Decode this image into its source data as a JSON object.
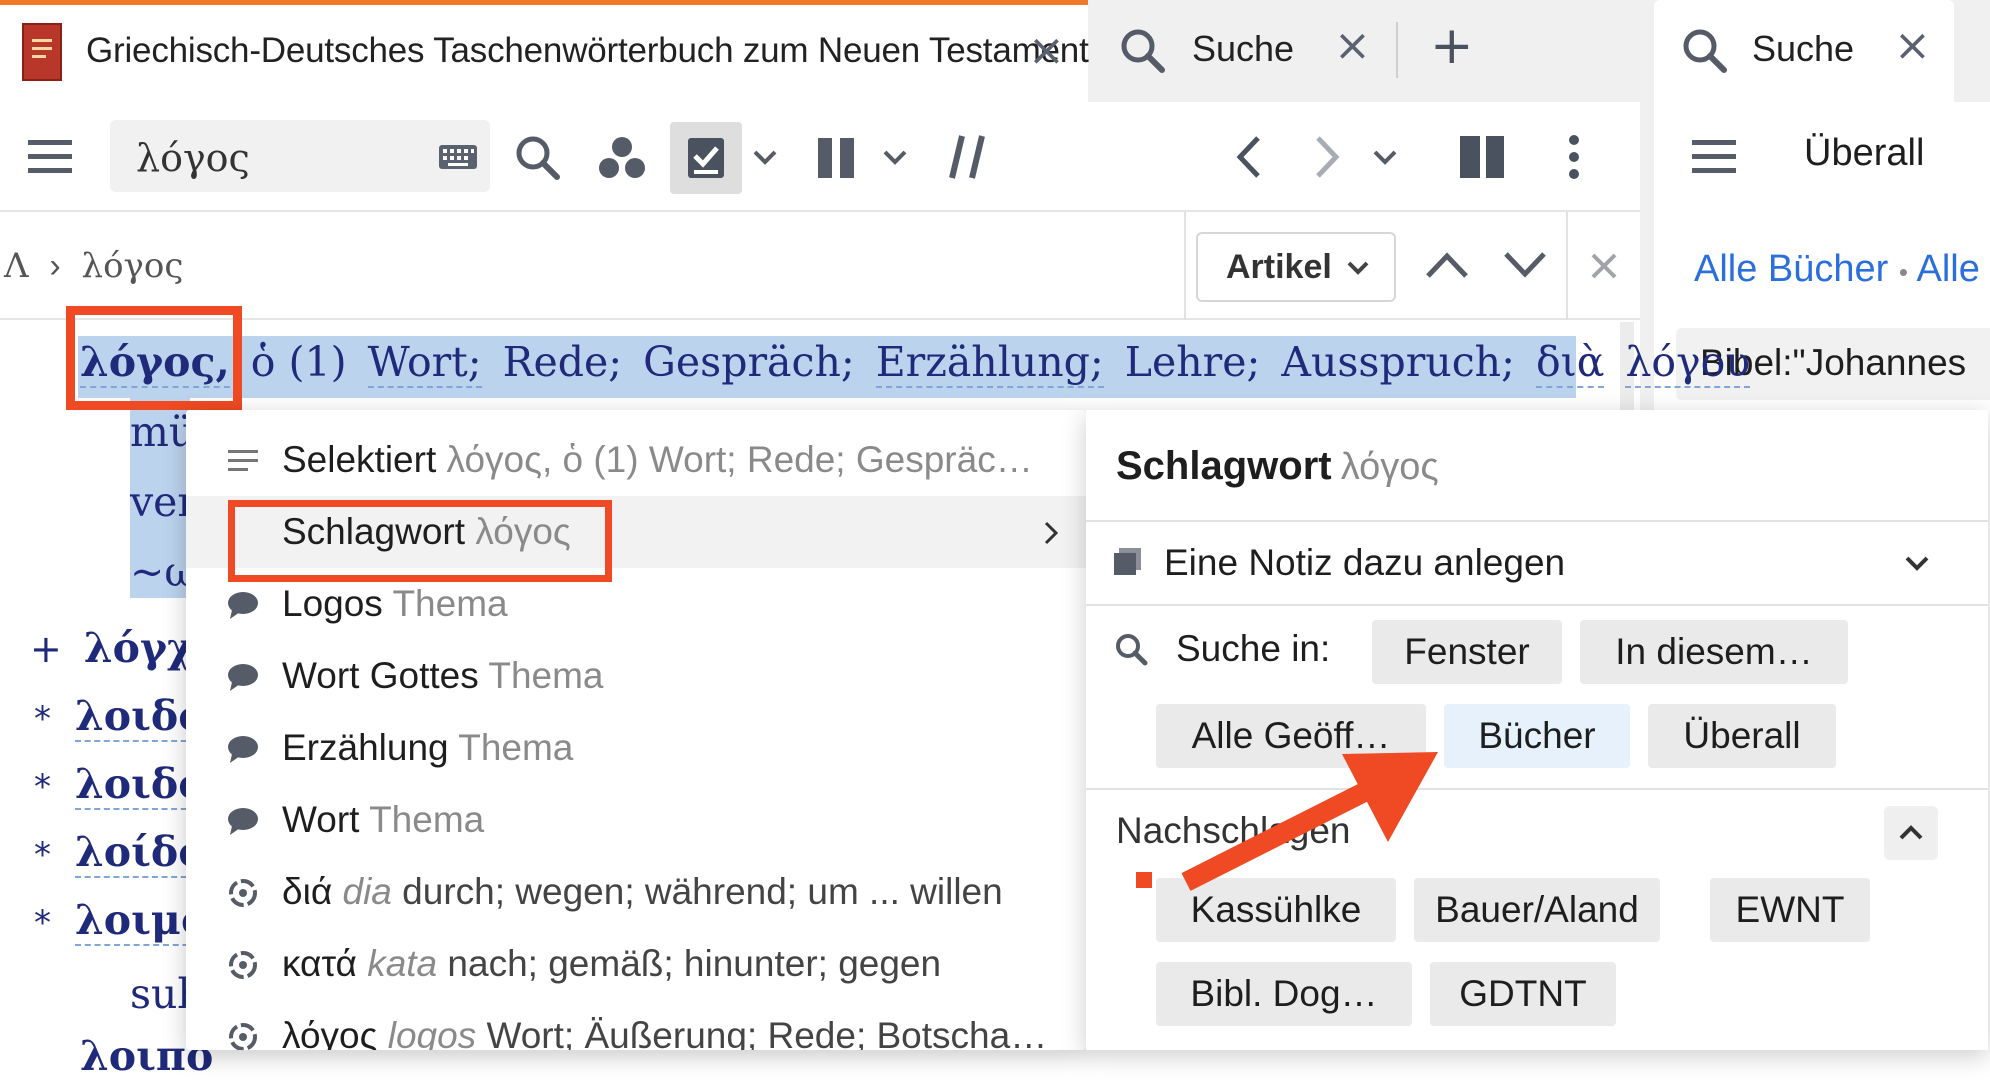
{
  "tabs": {
    "book_title": "Griechisch-Deutsches Taschenwörterbuch zum Neuen Testament",
    "search_tab": "Suche",
    "right_search_tab": "Suche"
  },
  "toolbar": {
    "search_value": "λόγος"
  },
  "right_toolbar": {
    "scope": "Überall"
  },
  "right_panel": {
    "books_link": "Alle Bücher",
    "bullet": "•",
    "alle_partial": "Alle",
    "query": "Bibel:\"Johannes"
  },
  "breadcrumb": {
    "root": "Λ",
    "sep": "›",
    "current": "λόγος"
  },
  "nav": {
    "artikel": "Artikel"
  },
  "article": {
    "headword": "λόγος,",
    "line1_rest": "ὁ (1)",
    "line1_words": [
      "Wort;",
      "Rede;",
      "Gespräch;",
      "Erzählung;",
      "Lehre;",
      "Ausspruch;",
      "διὰ",
      "λόγου"
    ],
    "line2_fragment": "mü",
    "line3_fragment": "ver",
    "line4_fragment": "~ω",
    "entries": [
      {
        "marker": "+",
        "word": "λόγχι"
      },
      {
        "marker": "*",
        "word": "λοιδο"
      },
      {
        "marker": "*",
        "word": "λοιδο"
      },
      {
        "marker": "*",
        "word": "λοίδο"
      },
      {
        "marker": "*",
        "word": "λοιμό"
      }
    ],
    "sub_fragment": "sub",
    "last_fragment": "λοιπό"
  },
  "context_menu": [
    {
      "label": "Selektiert",
      "detail": "λόγος, ὁ (1) Wort; Rede; Gespräc…",
      "icon": "lines-icon"
    },
    {
      "label": "Schlagwort",
      "detail": "λόγος",
      "icon": "none"
    },
    {
      "label": "Logos",
      "detail": "Thema",
      "icon": "speech-bubble-icon"
    },
    {
      "label": "Wort Gottes",
      "detail": "Thema",
      "icon": "speech-bubble-icon"
    },
    {
      "label": "Erzählung",
      "detail": "Thema",
      "icon": "speech-bubble-icon"
    },
    {
      "label": "Wort",
      "detail": "Thema",
      "icon": "speech-bubble-icon"
    },
    {
      "label": "διά",
      "detail_italic": "dia",
      "detail": "durch; wegen; während; um ... willen",
      "icon": "lemma-icon"
    },
    {
      "label": "κατά",
      "detail_italic": "kata",
      "detail": "nach; gemäß; hinunter; gegen",
      "icon": "lemma-icon"
    },
    {
      "label": "λόγος",
      "detail_italic": "logos",
      "detail": "Wort; Äußerung; Rede; Botscha…",
      "icon": "lemma-icon"
    }
  ],
  "submenu": {
    "title": "Schlagwort",
    "title_word": "λόγος",
    "note": "Eine Notiz dazu anlegen",
    "search_in": "Suche in:",
    "search_buttons": [
      "Fenster",
      "In diesem…",
      "Alle Geöff…",
      "Bücher",
      "Überall"
    ],
    "lookup": "Nachschlagen",
    "lookup_buttons": [
      "Kassühlke",
      "Bauer/Aland",
      "EWNT",
      "Bibl. Dog…",
      "GDTNT"
    ]
  },
  "colors": {
    "accent_orange": "#f07a2a",
    "highlight": "#ef4a23",
    "selection": "#bcd3ee",
    "link_blue": "#2a6fdb",
    "greek_blue": "#1f2a7a"
  }
}
